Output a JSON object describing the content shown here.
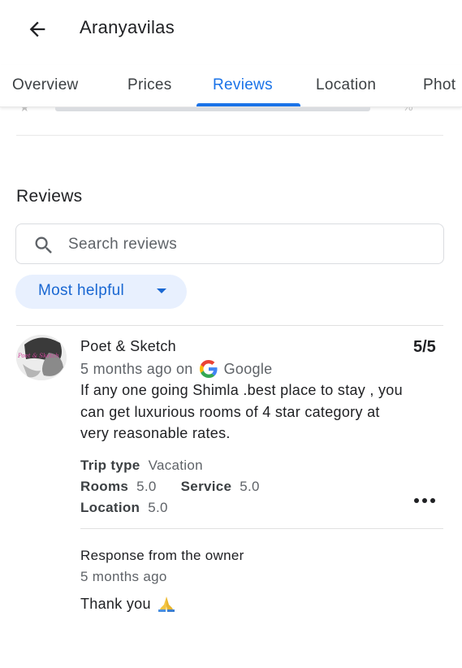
{
  "header": {
    "title": "Aranyavilas",
    "back_icon": "arrow-back-icon"
  },
  "tabs": [
    {
      "label": "Overview",
      "active": false
    },
    {
      "label": "Prices",
      "active": false
    },
    {
      "label": "Reviews",
      "active": true
    },
    {
      "label": "Location",
      "active": false
    },
    {
      "label": "Phot",
      "active": false
    }
  ],
  "reviews_section": {
    "title": "Reviews",
    "search": {
      "placeholder": "Search reviews",
      "value": "",
      "icon": "search-icon"
    },
    "sort": {
      "label": "Most helpful",
      "icon": "caret-down-icon"
    }
  },
  "review": {
    "author": "Poet & Sketch",
    "avatar_text": "Poet & Sketch",
    "score": "5/5",
    "time": "5 months ago on",
    "source": "Google",
    "source_icon": "google-g-icon",
    "text": "If any one going Shimla .best place to stay , you can get luxurious rooms of 4 star category at very reasonable rates.",
    "attributes": {
      "trip_type_label": "Trip type",
      "trip_type_value": "Vacation",
      "rooms_label": "Rooms",
      "rooms_value": "5.0",
      "service_label": "Service",
      "service_value": "5.0",
      "location_label": "Location",
      "location_value": "5.0"
    },
    "more_icon": "more-horizontal-icon",
    "owner_response": {
      "title": "Response from the owner",
      "time": "5 months ago",
      "text": "Thank you",
      "emoji_icon": "folded-hands-icon"
    }
  },
  "colors": {
    "accent": "#1a73e8",
    "chip_bg": "#e8f0fe",
    "chip_text": "#1967d2",
    "text_primary": "#202124",
    "text_secondary": "#5f6368",
    "divider": "#e0e0e0"
  }
}
